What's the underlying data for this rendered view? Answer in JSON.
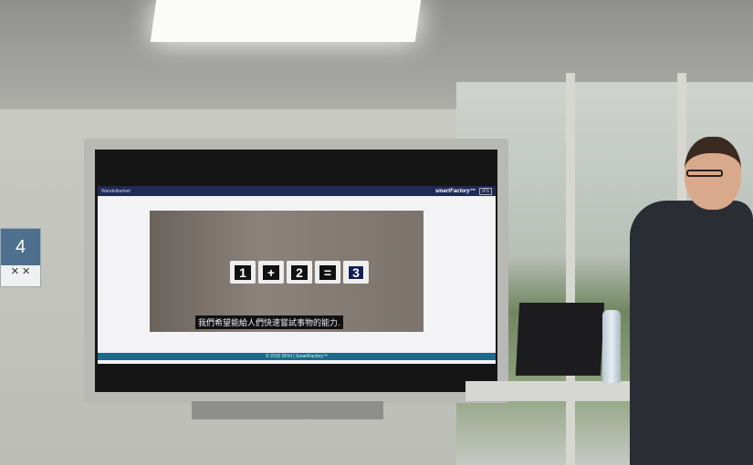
{
  "sign": {
    "number": "4",
    "label": "✕ ✕"
  },
  "slide": {
    "header_left": "Wandelbarkeit",
    "brand": "smartFactory™",
    "partner_logo": "IFS",
    "equation_tiles": [
      "1",
      "+",
      "2",
      "=",
      "3"
    ],
    "subtitle": "我們希望能給人們快速嘗試事物的能力.",
    "footer": "© 2015 DFKI | SmartFactory™"
  }
}
